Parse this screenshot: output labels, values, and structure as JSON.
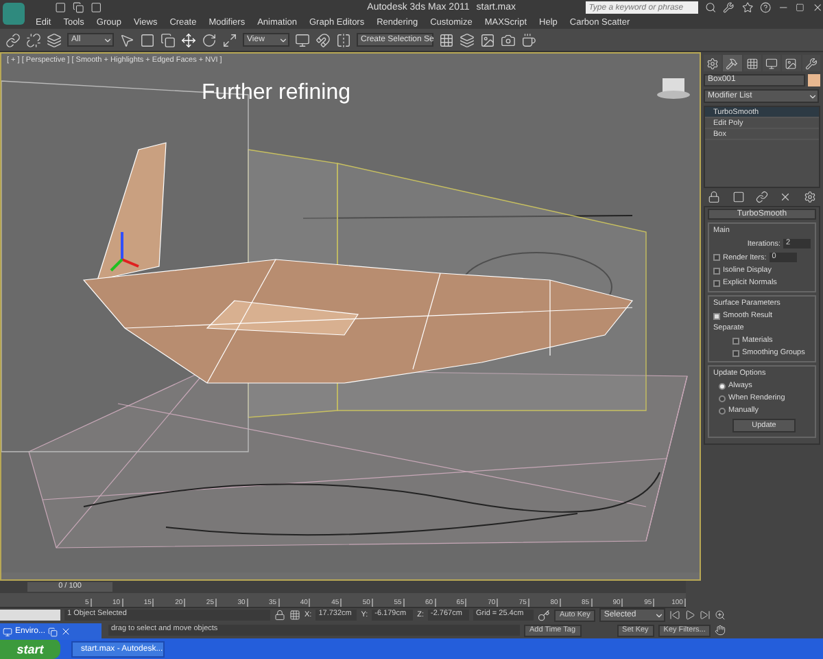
{
  "window": {
    "title": "Autodesk 3ds Max  2011",
    "file": "start.max",
    "search": {
      "placeholder": "Type a keyword or phrase"
    }
  },
  "menu": [
    "Edit",
    "Tools",
    "Group",
    "Views",
    "Create",
    "Modifiers",
    "Animation",
    "Graph Editors",
    "Rendering",
    "Customize",
    "MAXScript",
    "Help",
    "Carbon Scatter"
  ],
  "toolbar": {
    "filter": "All",
    "coord": "View",
    "selection_set": "Create Selection Se"
  },
  "viewport": {
    "label": "[ + ] [ Perspective ] [ Smooth + Highlights + Edged Faces + NVI ]",
    "caption": "Further refining"
  },
  "command_panel": {
    "object_name": "Box001",
    "modifier_list": "Modifier List",
    "stack": [
      {
        "name": "TurboSmooth",
        "selected": true
      },
      {
        "name": "Edit Poly",
        "selected": false
      },
      {
        "name": "Box",
        "selected": false
      }
    ],
    "rollout": {
      "title": "TurboSmooth",
      "main": {
        "title": "Main",
        "iterations_label": "Iterations:",
        "iterations": "2",
        "render_iters_label": "Render Iters:",
        "render_iters": "0",
        "render_iters_checked": false,
        "options": [
          {
            "label": "Isoline Display",
            "checked": false
          },
          {
            "label": "Explicit Normals",
            "checked": false
          }
        ]
      },
      "surface": {
        "title": "Surface Parameters",
        "smooth_result": {
          "label": "Smooth Result",
          "checked": true
        },
        "separate": "Separate",
        "options": [
          {
            "label": "Materials",
            "checked": false
          },
          {
            "label": "Smoothing Groups",
            "checked": false
          }
        ]
      },
      "update": {
        "title": "Update Options",
        "options": [
          {
            "label": "Always",
            "selected": true
          },
          {
            "label": "When Rendering",
            "selected": false
          },
          {
            "label": "Manually",
            "selected": false
          }
        ],
        "button": "Update"
      }
    }
  },
  "timeline": {
    "position": "0 / 100",
    "level": 0,
    "ticks": [
      "5",
      "10",
      "15",
      "20",
      "25",
      "30",
      "35",
      "40",
      "45",
      "50",
      "55",
      "60",
      "65",
      "70",
      "75",
      "80",
      "85",
      "90",
      "95",
      "100"
    ]
  },
  "status": {
    "selected": "1 Object Selected",
    "prompt": "drag to select and move objects",
    "x_label": "X:",
    "x": "17.732cm",
    "y_label": "Y:",
    "y": "-6.179cm",
    "z_label": "Z:",
    "z": "-2.767cm",
    "grid": "Grid = 25.4cm",
    "time_tag": "Add Time Tag",
    "auto_key": "Auto Key",
    "key_mode": "Selected",
    "set_key": "Set Key",
    "key_filters": "Key Filters..."
  },
  "floating_window": {
    "title": "Enviro..."
  },
  "taskbar": {
    "start": "start",
    "tasks": [
      "start.max - Autodesk..."
    ]
  }
}
